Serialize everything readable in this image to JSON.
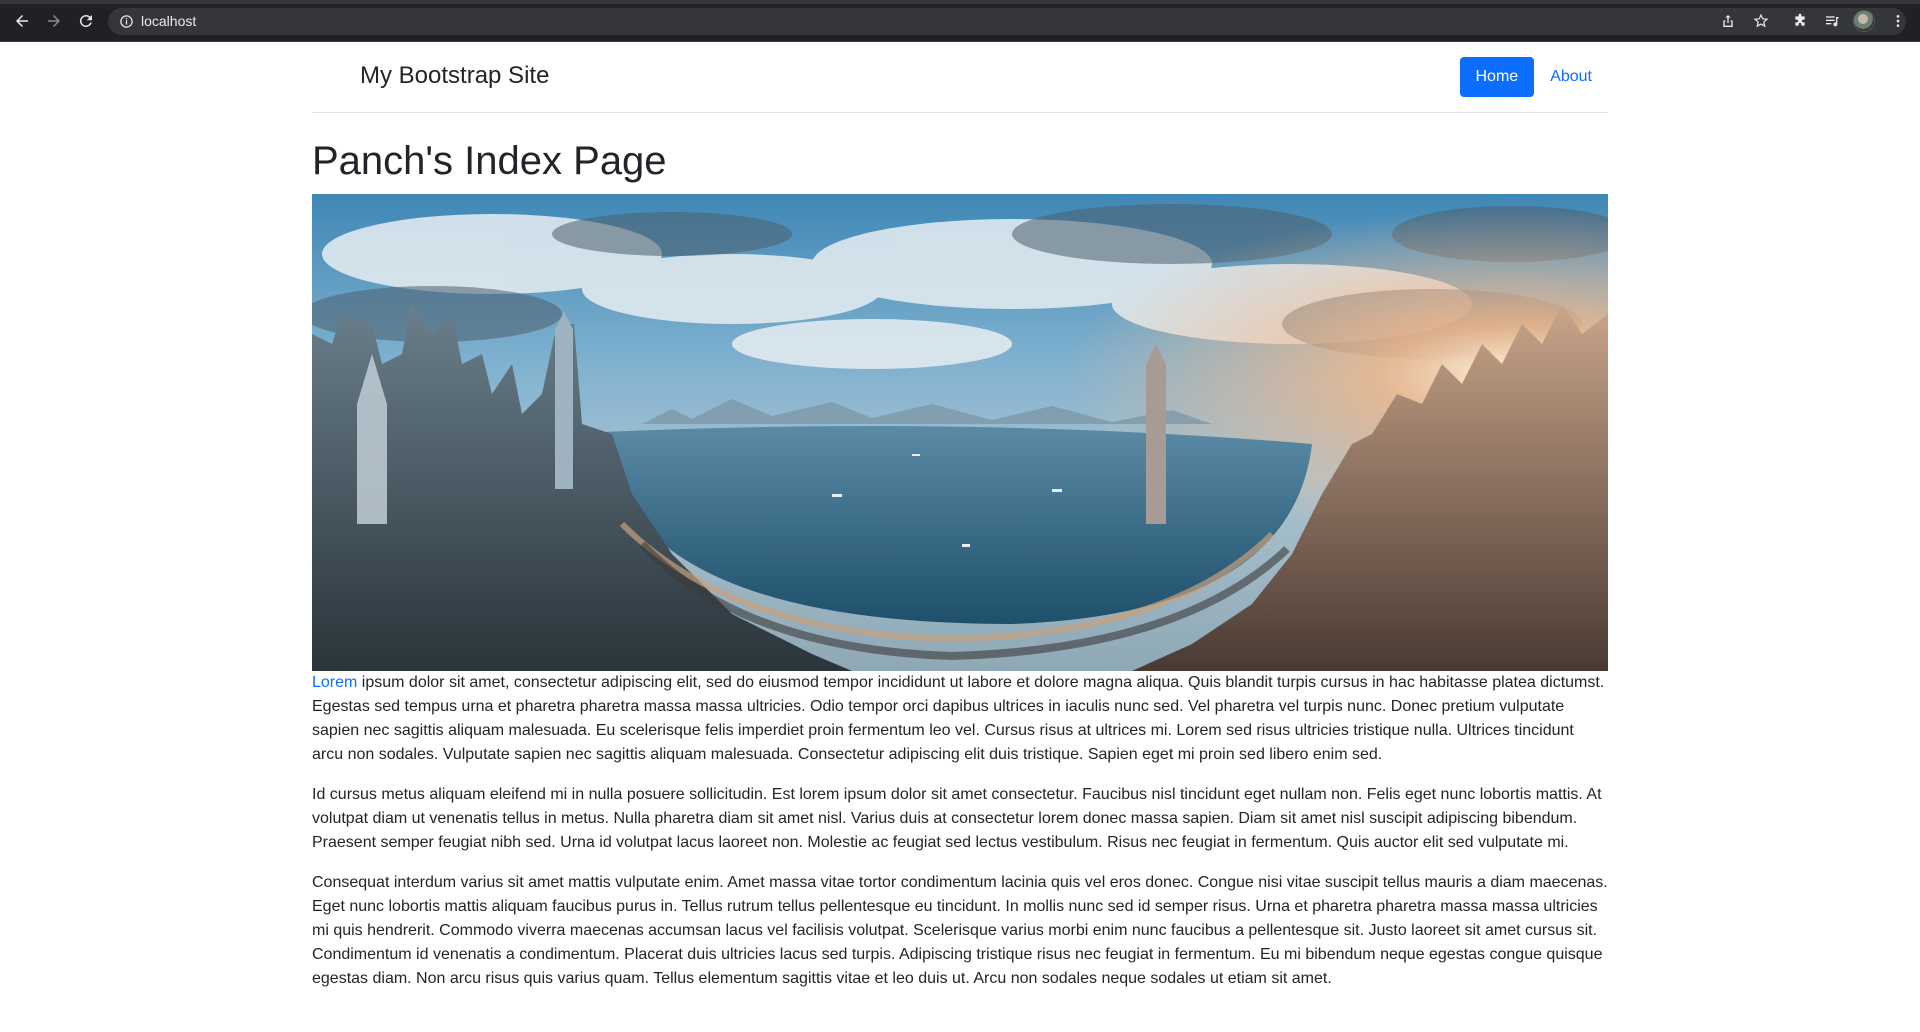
{
  "browser": {
    "url": "localhost"
  },
  "header": {
    "brand": "My Bootstrap Site",
    "nav": [
      {
        "label": "Home",
        "active": true
      },
      {
        "label": "About",
        "active": false
      }
    ]
  },
  "main": {
    "title": "Panch's Index Page",
    "hero_image": "city-harbor-panorama",
    "paragraphs": [
      {
        "link_text": "Lorem",
        "text": " ipsum dolor sit amet, consectetur adipiscing elit, sed do eiusmod tempor incididunt ut labore et dolore magna aliqua. Quis blandit turpis cursus in hac habitasse platea dictumst. Egestas sed tempus urna et pharetra pharetra massa massa ultricies. Odio tempor orci dapibus ultrices in iaculis nunc sed. Vel pharetra vel turpis nunc. Donec pretium vulputate sapien nec sagittis aliquam malesuada. Eu scelerisque felis imperdiet proin fermentum leo vel. Cursus risus at ultrices mi. Lorem sed risus ultricies tristique nulla. Ultrices tincidunt arcu non sodales. Vulputate sapien nec sagittis aliquam malesuada. Consectetur adipiscing elit duis tristique. Sapien eget mi proin sed libero enim sed."
      },
      {
        "text": "Id cursus metus aliquam eleifend mi in nulla posuere sollicitudin. Est lorem ipsum dolor sit amet consectetur. Faucibus nisl tincidunt eget nullam non. Felis eget nunc lobortis mattis. At volutpat diam ut venenatis tellus in metus. Nulla pharetra diam sit amet nisl. Varius duis at consectetur lorem donec massa sapien. Diam sit amet nisl suscipit adipiscing bibendum. Praesent semper feugiat nibh sed. Urna id volutpat lacus laoreet non. Molestie ac feugiat sed lectus vestibulum. Risus nec feugiat in fermentum. Quis auctor elit sed vulputate mi."
      },
      {
        "text": "Consequat interdum varius sit amet mattis vulputate enim. Amet massa vitae tortor condimentum lacinia quis vel eros donec. Congue nisi vitae suscipit tellus mauris a diam maecenas. Eget nunc lobortis mattis aliquam faucibus purus in. Tellus rutrum tellus pellentesque eu tincidunt. In mollis nunc sed id semper risus. Urna et pharetra pharetra massa massa ultricies mi quis hendrerit. Commodo viverra maecenas accumsan lacus vel facilisis volutpat. Scelerisque varius morbi enim nunc faucibus a pellentesque sit. Justo laoreet sit amet cursus sit. Condimentum id venenatis a condimentum. Placerat duis ultricies lacus sed turpis. Adipiscing tristique risus nec feugiat in fermentum. Eu mi bibendum neque egestas congue quisque egestas diam. Non arcu risus quis varius quam. Tellus elementum sagittis vitae et leo duis ut. Arcu non sodales neque sodales ut etiam sit amet."
      }
    ]
  },
  "colors": {
    "accent": "#0d6efd",
    "text": "#212529",
    "chrome_bg": "#202124"
  }
}
